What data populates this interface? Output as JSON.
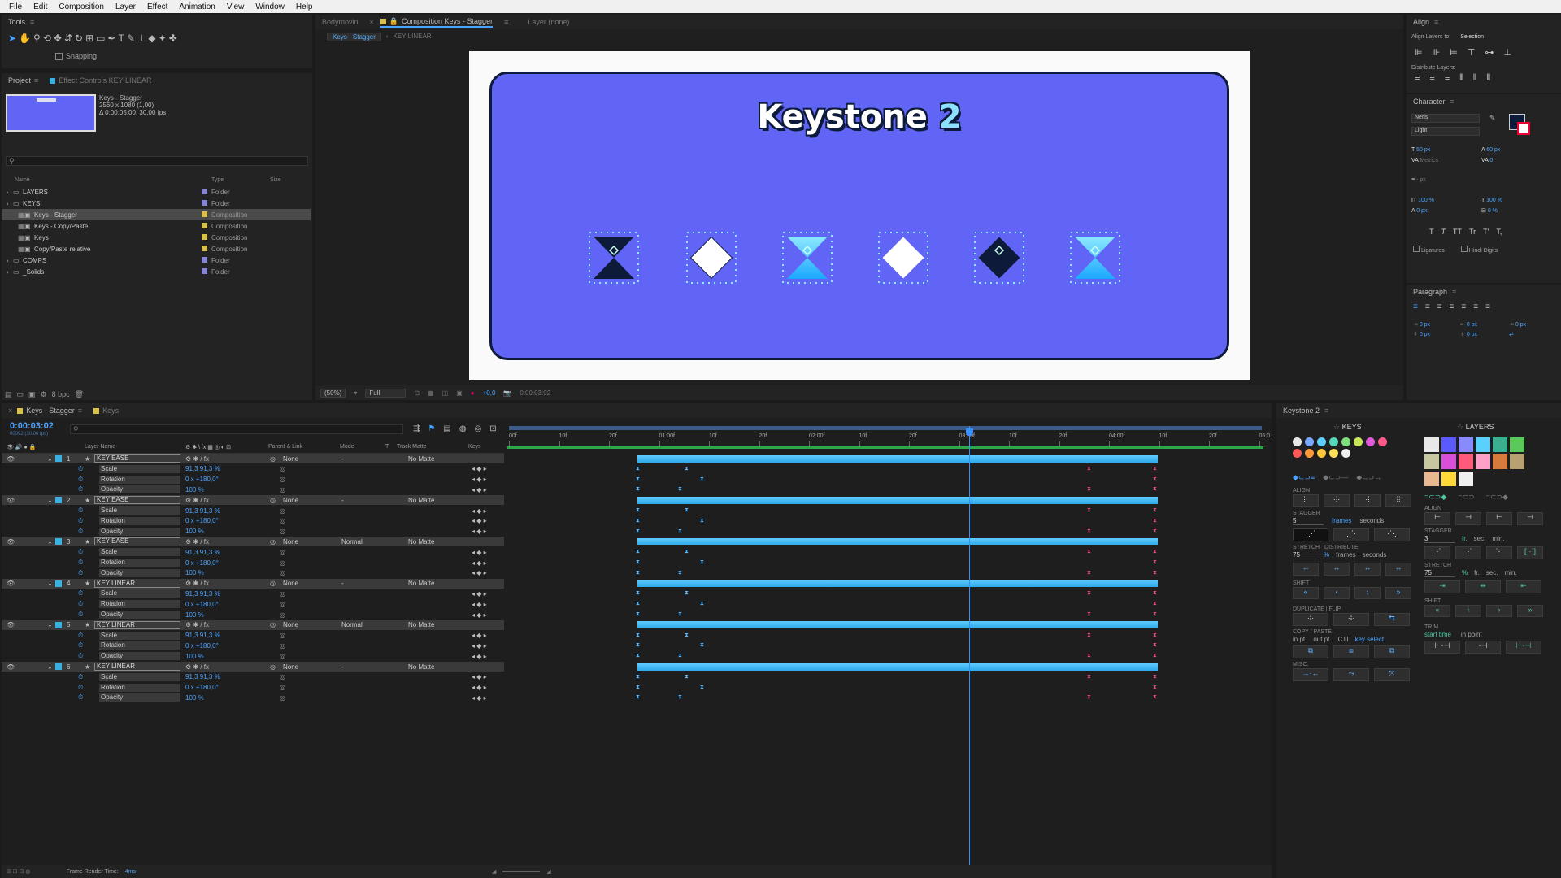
{
  "menu": [
    "File",
    "Edit",
    "Composition",
    "Layer",
    "Effect",
    "Animation",
    "View",
    "Window",
    "Help"
  ],
  "tools": {
    "title": "Tools",
    "snapping": "Snapping"
  },
  "project": {
    "tab": "Project",
    "effect_tab": "Effect Controls KEY LINEAR",
    "comp_name": "Keys - Stagger",
    "comp_res": "2560 x 1080 (1,00)",
    "comp_dur": "Δ 0:00:05:00, 30,00 fps",
    "cols": [
      "Name",
      "Type",
      "Size"
    ],
    "items": [
      {
        "name": "LAYERS",
        "type": "Folder",
        "color": "#8585d6",
        "indent": 0,
        "kind": "folder"
      },
      {
        "name": "KEYS",
        "type": "Folder",
        "color": "#8585d6",
        "indent": 0,
        "kind": "folder"
      },
      {
        "name": "Keys - Stagger",
        "type": "Composition",
        "color": "#d8c04a",
        "indent": 1,
        "kind": "comp",
        "selected": true
      },
      {
        "name": "Keys - Copy/Paste",
        "type": "Composition",
        "color": "#d8c04a",
        "indent": 1,
        "kind": "comp"
      },
      {
        "name": "Keys",
        "type": "Composition",
        "color": "#d8c04a",
        "indent": 1,
        "kind": "comp"
      },
      {
        "name": "Copy/Paste relative",
        "type": "Composition",
        "color": "#d8c04a",
        "indent": 1,
        "kind": "comp"
      },
      {
        "name": "COMPS",
        "type": "Folder",
        "color": "#8585d6",
        "indent": 0,
        "kind": "folder"
      },
      {
        "name": "_Solids",
        "type": "Folder",
        "color": "#8585d6",
        "indent": 0,
        "kind": "folder"
      }
    ],
    "bpc": "8 bpc"
  },
  "viewer": {
    "tabs": [
      "Bodymovin",
      "Composition Keys - Stagger",
      "Layer (none)"
    ],
    "crumbs": [
      "Keys - Stagger",
      "KEY LINEAR"
    ],
    "title_main": "Keystone",
    "title_num": "2",
    "zoom": "(50%)",
    "quality": "Full",
    "time": "0:00:03:02",
    "exposure": "+0,0"
  },
  "timeline": {
    "tabs": [
      "Keys - Stagger",
      "Keys"
    ],
    "timecode": "0:00:03:02",
    "fps_sub": "00092 (30.00 fps)",
    "col_headers": [
      "Layer Name",
      "Parent & Link",
      "Mode",
      "T",
      "Track Matte",
      "Keys"
    ],
    "ruler": [
      "00f",
      "10f",
      "20f",
      "01:00f",
      "10f",
      "20f",
      "02:00f",
      "10f",
      "20f",
      "03:00f",
      "10f",
      "20f",
      "04:00f",
      "10f",
      "20f",
      "05:0"
    ],
    "layers": [
      {
        "num": "1",
        "name": "KEY EASE",
        "parent": "None",
        "mode": "-",
        "matte": "No Matte"
      },
      {
        "num": "2",
        "name": "KEY EASE",
        "parent": "None",
        "mode": "-",
        "matte": "No Matte"
      },
      {
        "num": "3",
        "name": "KEY EASE",
        "parent": "None",
        "mode": "Normal",
        "matte": "No Matte"
      },
      {
        "num": "4",
        "name": "KEY LINEAR",
        "parent": "None",
        "mode": "-",
        "matte": "No Matte"
      },
      {
        "num": "5",
        "name": "KEY LINEAR",
        "parent": "None",
        "mode": "Normal",
        "matte": "No Matte"
      },
      {
        "num": "6",
        "name": "KEY LINEAR",
        "parent": "None",
        "mode": "-",
        "matte": "No Matte"
      }
    ],
    "props": [
      {
        "name": "Scale",
        "value": "91,3 91,3 %"
      },
      {
        "name": "Rotation",
        "value": "0 x +180,0°"
      },
      {
        "name": "Opacity",
        "value": "100 %"
      }
    ],
    "render_time_label": "Frame Render Time:",
    "render_time": "4ms"
  },
  "align": {
    "title": "Align",
    "align_to_label": "Align Layers to:",
    "align_to": "Selection",
    "distribute": "Distribute Layers:"
  },
  "character": {
    "title": "Character",
    "font": "Neris",
    "style": "Light",
    "size": "50 px",
    "leading": "60 px",
    "kerning": "Metrics",
    "tracking": "0",
    "stroke": "- px",
    "vscale": "100 %",
    "hscale": "100 %",
    "baseline": "0 px",
    "tsume": "0 %",
    "ligatures": "Ligatures",
    "hindi": "Hindi Digits",
    "caps": [
      "T",
      "T",
      "TT",
      "Tr",
      "T'",
      "T,"
    ]
  },
  "paragraph": {
    "title": "Paragraph",
    "vals": [
      "0 px",
      "0 px",
      "0 px",
      "0 px",
      "0 px"
    ]
  },
  "keystone": {
    "title": "Keystone 2",
    "keys": "KEYS",
    "layers": "LAYERS",
    "align": "ALIGN",
    "stagger": "STAGGER",
    "stagger_val": "5",
    "frames": "frames",
    "seconds": "seconds",
    "stretch": "STRETCH",
    "distribute": "DISTRIBUTE",
    "stretch_val": "75",
    "pct": "%",
    "shift": "SHIFT",
    "duplicate": "DUPLICATE",
    "flip": "FLIP",
    "copy_paste": "COPY / PASTE",
    "in_pt": "in pt.",
    "out_pt": "out pt.",
    "cti": "CTI",
    "key_select": "key select.",
    "misc": "MISC.",
    "l_stagger_val": "3",
    "fr": "fr.",
    "sec": "sec.",
    "min": "min.",
    "l_stretch_val": "75",
    "trim": "TRIM",
    "start_time": "start time",
    "in_point": "in point",
    "key_colors": [
      "#e8e8e8",
      "#7aa8ff",
      "#5bd0ff",
      "#55d6b8",
      "#7de07a",
      "#c8e85a",
      "#e05ad8",
      "#ff5a8a",
      "#ff5a5a",
      "#ff9a3a",
      "#ffc83a",
      "#ffe05a",
      "#f0f0f0"
    ],
    "layer_colors": [
      "#e8e8e8",
      "#5a5aff",
      "#8a8aff",
      "#5ad0ff",
      "#3ab090",
      "#5ac85a",
      "#c8c8a0",
      "#d850d8",
      "#ff5a7a",
      "#ffa0c8",
      "#d87a3a",
      "#b8a070",
      "#e8b890",
      "#ffd83a",
      "#f0f0f0"
    ]
  }
}
